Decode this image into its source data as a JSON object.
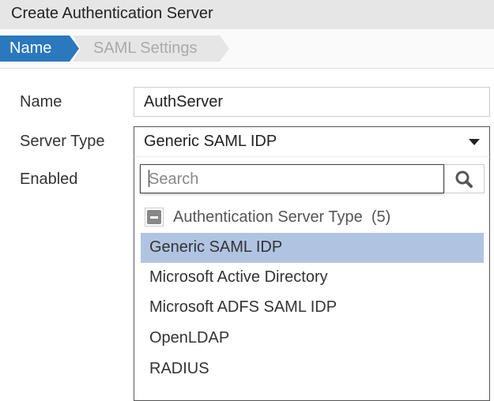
{
  "title": "Create Authentication Server",
  "steps": [
    "Name",
    "SAML Settings"
  ],
  "form": {
    "name_label": "Name",
    "name_value": "AuthServer",
    "type_label": "Server Type",
    "type_value": "Generic SAML IDP",
    "enabled_label": "Enabled"
  },
  "dropdown": {
    "search_placeholder": "Search",
    "group_label": "Authentication Server Type  (5)",
    "options": [
      "Generic SAML IDP",
      "Microsoft Active Directory",
      "Microsoft ADFS SAML IDP",
      "OpenLDAP",
      "RADIUS"
    ],
    "selected": "Generic SAML IDP"
  },
  "colors": {
    "accent": "#2a78be",
    "selected": "#b0c4e2"
  }
}
